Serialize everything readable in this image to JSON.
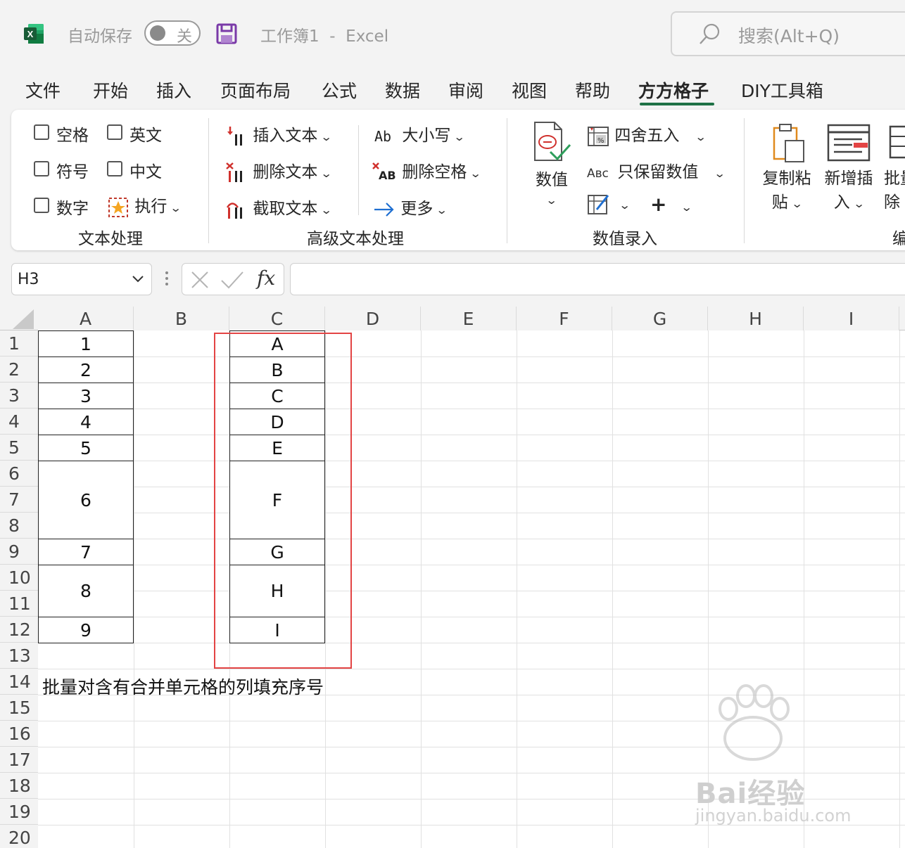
{
  "titlebar": {
    "autosave_label": "自动保存",
    "autosave_state": "关",
    "doc_title": "工作簿1  -  Excel",
    "search_placeholder": "搜索(Alt+Q)",
    "app_icon": "excel-icon",
    "save_icon": "save-icon"
  },
  "menu": {
    "tabs": [
      "文件",
      "开始",
      "插入",
      "页面布局",
      "公式",
      "数据",
      "审阅",
      "视图",
      "帮助",
      "方方格子",
      "DIY工具箱"
    ],
    "active_tab": "方方格子"
  },
  "ribbon": {
    "text_group": {
      "label": "文本处理",
      "checkboxes": [
        "空格",
        "英文",
        "符号",
        "中文",
        "数字"
      ],
      "execute_label": "执行"
    },
    "advanced_group": {
      "label": "高级文本处理",
      "insert_text": "插入文本",
      "delete_text": "删除文本",
      "extract_text": "截取文本",
      "case_label": "大小写",
      "delete_space": "删除空格",
      "more_label": "更多"
    },
    "number_group": {
      "label": "数值录入",
      "value_button": "数值",
      "round_label": "四舍五入",
      "keep_value_label": "只保留数值"
    },
    "edit_group": {
      "copy_paste_line1": "复制粘",
      "copy_paste_line2": "贴",
      "add_insert_line1": "新增插",
      "add_insert_line2": "入",
      "batch_line1": "批量",
      "batch_line2": "除",
      "label_partial": "编"
    }
  },
  "formula_bar": {
    "name_box": "H3",
    "fx": "fx",
    "formula": ""
  },
  "sheet": {
    "columns": [
      "A",
      "B",
      "C",
      "D",
      "E",
      "F",
      "G",
      "H",
      "I"
    ],
    "rows": [
      "1",
      "2",
      "3",
      "4",
      "5",
      "6",
      "7",
      "8",
      "9",
      "10",
      "11",
      "12",
      "13",
      "14",
      "15",
      "16",
      "17",
      "18",
      "19",
      "20"
    ],
    "col_a_values": [
      "1",
      "2",
      "3",
      "4",
      "5",
      "6",
      "7",
      "8",
      "9"
    ],
    "col_c_values": [
      "A",
      "B",
      "C",
      "D",
      "E",
      "F",
      "G",
      "H",
      "I"
    ],
    "note": "批量对含有合并单元格的列填充序号",
    "highlight_color": "#e34444"
  },
  "watermark": {
    "brand": "Bai经验",
    "url": "jingyan.baidu.com"
  },
  "colors": {
    "excel_green": "#1e7145",
    "save_purple": "#7a3aa8",
    "accent_red": "#e34444"
  }
}
